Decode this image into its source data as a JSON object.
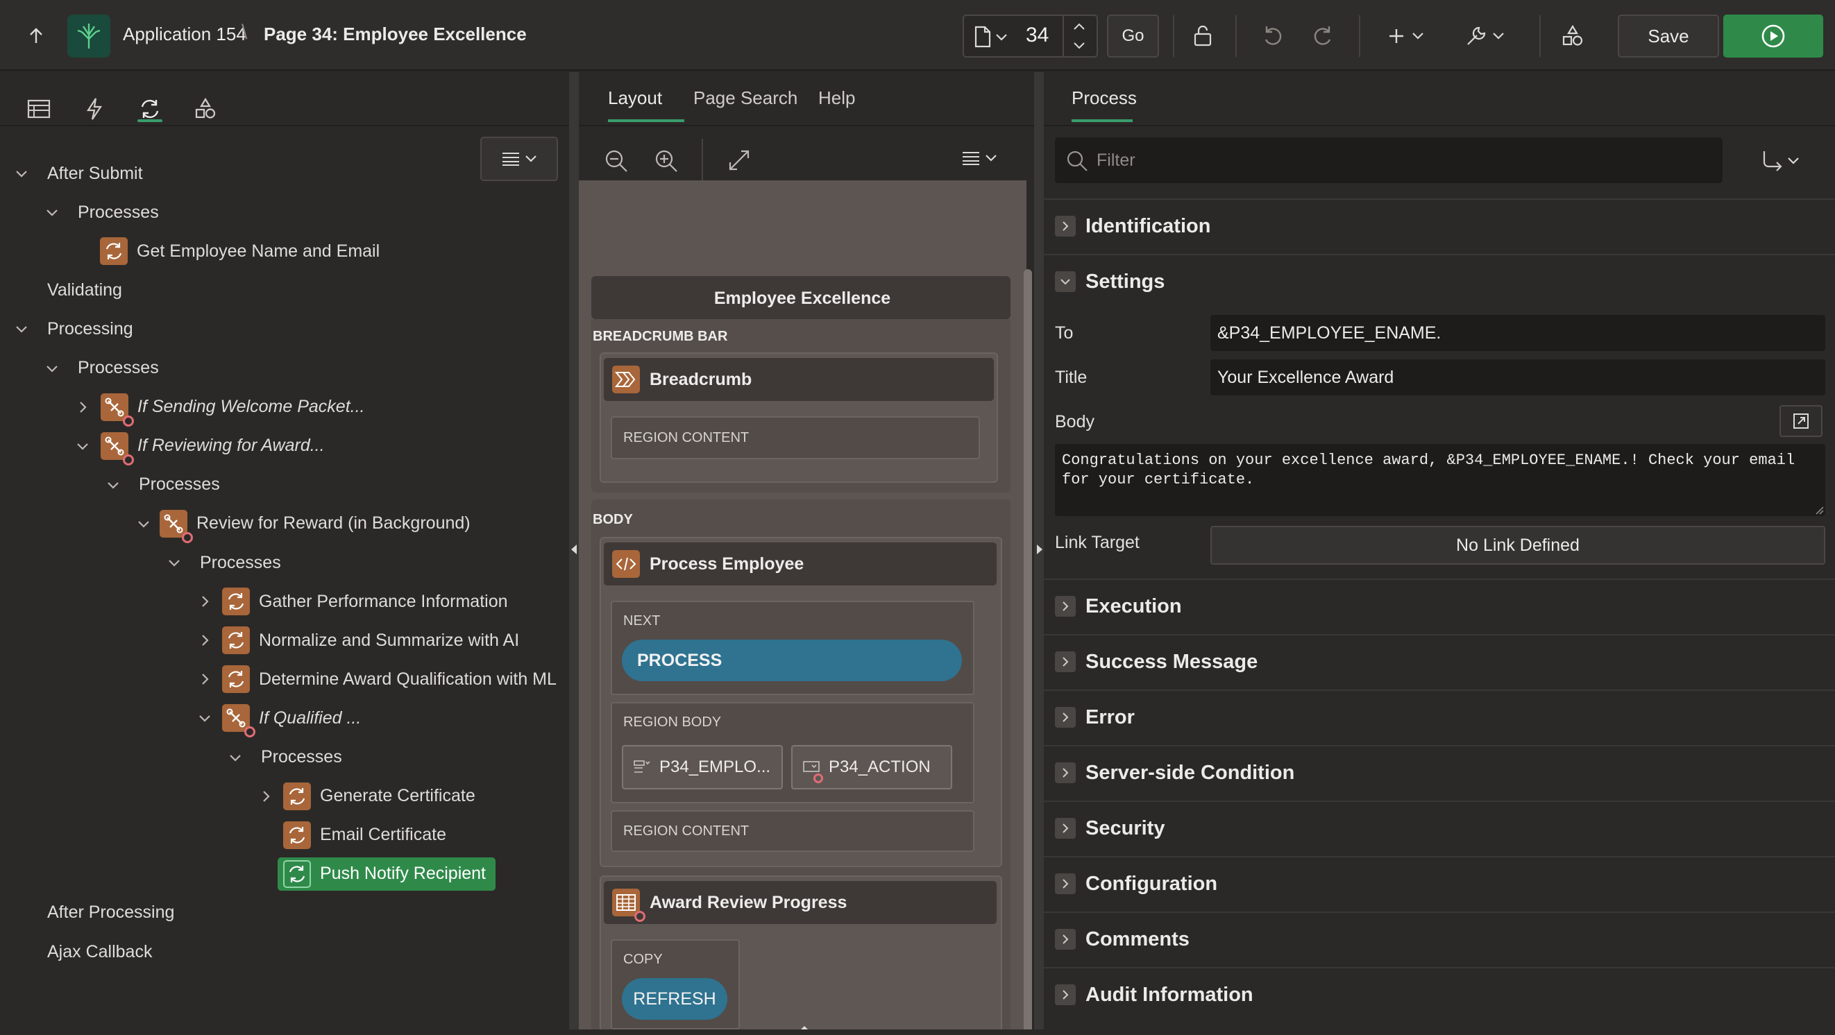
{
  "toolbar": {
    "app_name": "Application 154",
    "separator": "\\",
    "page_name": "Page 34: Employee Excellence",
    "page_number": "34",
    "go_label": "Go",
    "save_label": "Save"
  },
  "left_tree": {
    "nodes": [
      {
        "label": "After Submit"
      },
      {
        "label": "Processes"
      },
      {
        "label": "Get Employee Name and Email"
      },
      {
        "label": "Validating"
      },
      {
        "label": "Processing"
      },
      {
        "label": "Processes"
      },
      {
        "label": "If Sending Welcome Packet..."
      },
      {
        "label": "If Reviewing for Award..."
      },
      {
        "label": "Processes"
      },
      {
        "label": "Review for Reward (in Background)"
      },
      {
        "label": "Processes"
      },
      {
        "label": "Gather Performance Information"
      },
      {
        "label": "Normalize and Summarize with AI"
      },
      {
        "label": "Determine Award Qualification with ML"
      },
      {
        "label": "If Qualified ..."
      },
      {
        "label": "Processes"
      },
      {
        "label": "Generate Certificate"
      },
      {
        "label": "Email Certificate"
      },
      {
        "label": "Push Notify Recipient"
      },
      {
        "label": "After Processing"
      },
      {
        "label": "Ajax Callback"
      }
    ]
  },
  "middle": {
    "tabs": [
      {
        "label": "Layout"
      },
      {
        "label": "Page Search"
      },
      {
        "label": "Help"
      }
    ],
    "page_title": "Employee Excellence",
    "breadcrumb_bar_label": "BREADCRUMB BAR",
    "breadcrumb_region": "Breadcrumb",
    "region_content": "REGION CONTENT",
    "body_label": "BODY",
    "process_region": "Process Employee",
    "next_label": "NEXT",
    "process_button": "PROCESS",
    "region_body_label": "REGION BODY",
    "item1": "P34_EMPLO...",
    "item2": "P34_ACTION",
    "award_region": "Award Review Progress",
    "copy_label": "COPY",
    "refresh_button": "REFRESH"
  },
  "right": {
    "tab": "Process",
    "filter_placeholder": "Filter",
    "sections": {
      "identification": "Identification",
      "settings": "Settings",
      "execution": "Execution",
      "success_message": "Success Message",
      "error": "Error",
      "server_side_condition": "Server-side Condition",
      "security": "Security",
      "configuration": "Configuration",
      "comments": "Comments",
      "audit_information": "Audit Information"
    },
    "props": {
      "to_label": "To",
      "to_value": "&P34_EMPLOYEE_ENAME.",
      "title_label": "Title",
      "title_value": "Your Excellence Award",
      "body_label": "Body",
      "body_value": "Congratulations on your excellence award, &P34_EMPLOYEE_ENAME.! Check your email\nfor your certificate.",
      "link_target_label": "Link Target",
      "link_target_value": "No Link Defined"
    }
  },
  "colors": {
    "accent_green": "#2f8a4a",
    "tab_underline": "#3a9c6b",
    "component_orange": "#a8663a",
    "button_blue": "#2f7390",
    "canvas_bg": "#5c5552"
  }
}
